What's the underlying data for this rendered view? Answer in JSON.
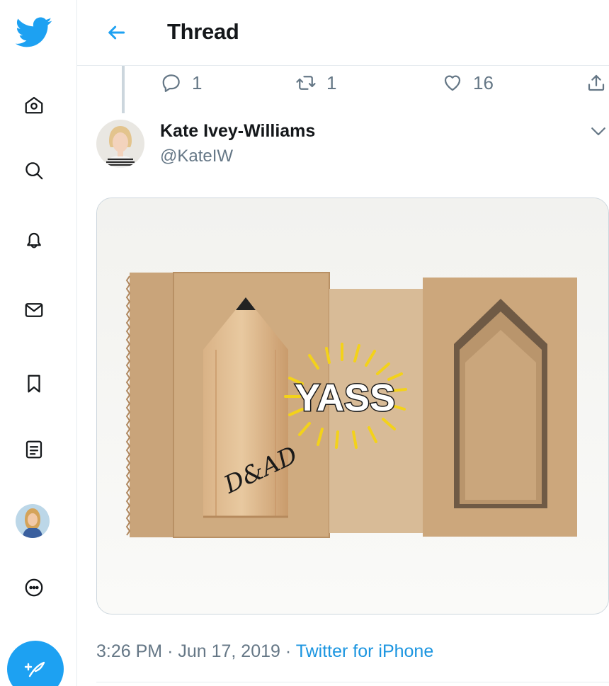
{
  "nav": {
    "items": [
      {
        "name": "twitter-logo-icon"
      },
      {
        "name": "home-icon"
      },
      {
        "name": "explore-icon"
      },
      {
        "name": "notifications-icon"
      },
      {
        "name": "messages-icon"
      },
      {
        "name": "bookmarks-icon"
      },
      {
        "name": "lists-icon"
      },
      {
        "name": "profile-avatar"
      },
      {
        "name": "more-icon"
      },
      {
        "name": "compose-tweet-icon"
      }
    ]
  },
  "header": {
    "title": "Thread"
  },
  "previous_tweet_actions": {
    "reply_count": "1",
    "retweet_count": "1",
    "like_count": "16"
  },
  "tweet": {
    "author_name": "Kate Ivey-Williams",
    "author_handle": "@KateIW",
    "photo": {
      "sticker_text": "YASS"
    },
    "time": "3:26 PM",
    "date": "Jun 17, 2019",
    "separator": "·",
    "source": "Twitter for iPhone"
  },
  "colors": {
    "accent": "#1da1f2",
    "secondary_text": "#657786",
    "primary_text": "#14171a"
  }
}
